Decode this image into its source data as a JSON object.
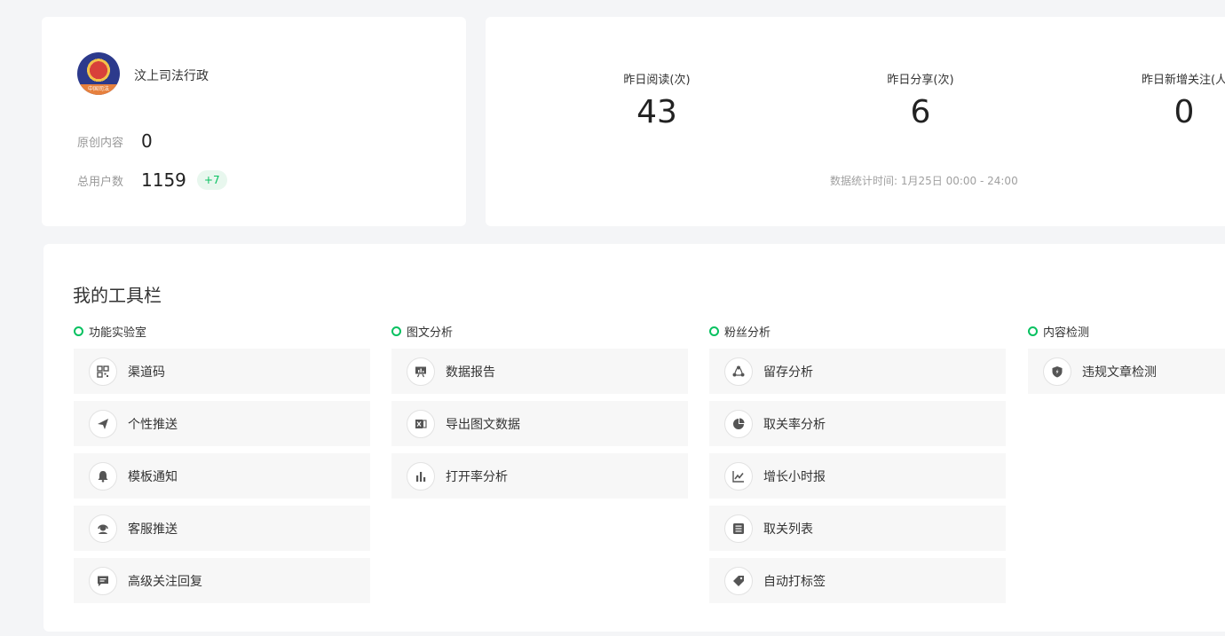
{
  "profile": {
    "name": "汶上司法行政",
    "avatar_badge": "中国司法",
    "original_label": "原创内容",
    "original_value": "0",
    "users_label": "总用户数",
    "users_value": "1159",
    "users_delta": "+7"
  },
  "stats": {
    "items": [
      {
        "label": "昨日阅读(次)",
        "value": "43"
      },
      {
        "label": "昨日分享(次)",
        "value": "6"
      },
      {
        "label": "昨日新增关注(人",
        "value": "0"
      }
    ],
    "note": "数据统计时间: 1月25日 00:00 - 24:00"
  },
  "toolbar": {
    "title": "我的工具栏",
    "groups": [
      {
        "title": "功能实验室",
        "items": [
          {
            "label": "渠道码",
            "icon": "qr-code-icon"
          },
          {
            "label": "个性推送",
            "icon": "paper-plane-icon"
          },
          {
            "label": "模板通知",
            "icon": "bell-icon"
          },
          {
            "label": "客服推送",
            "icon": "headset-icon"
          },
          {
            "label": "高级关注回复",
            "icon": "chat-icon"
          }
        ]
      },
      {
        "title": "图文分析",
        "items": [
          {
            "label": "数据报告",
            "icon": "presentation-icon"
          },
          {
            "label": "导出图文数据",
            "icon": "excel-icon"
          },
          {
            "label": "打开率分析",
            "icon": "bar-chart-icon"
          }
        ]
      },
      {
        "title": "粉丝分析",
        "items": [
          {
            "label": "留存分析",
            "icon": "cycle-icon"
          },
          {
            "label": "取关率分析",
            "icon": "pie-chart-icon"
          },
          {
            "label": "增长小时报",
            "icon": "line-chart-icon"
          },
          {
            "label": "取关列表",
            "icon": "list-icon"
          },
          {
            "label": "自动打标签",
            "icon": "tag-icon"
          }
        ]
      },
      {
        "title": "内容检测",
        "items": [
          {
            "label": "违规文章检测",
            "icon": "shield-icon"
          }
        ]
      }
    ]
  },
  "colors": {
    "accent": "#07c160",
    "page_bg": "#f4f5f7",
    "card_bg": "#ffffff",
    "item_bg": "#f7f7f7"
  }
}
